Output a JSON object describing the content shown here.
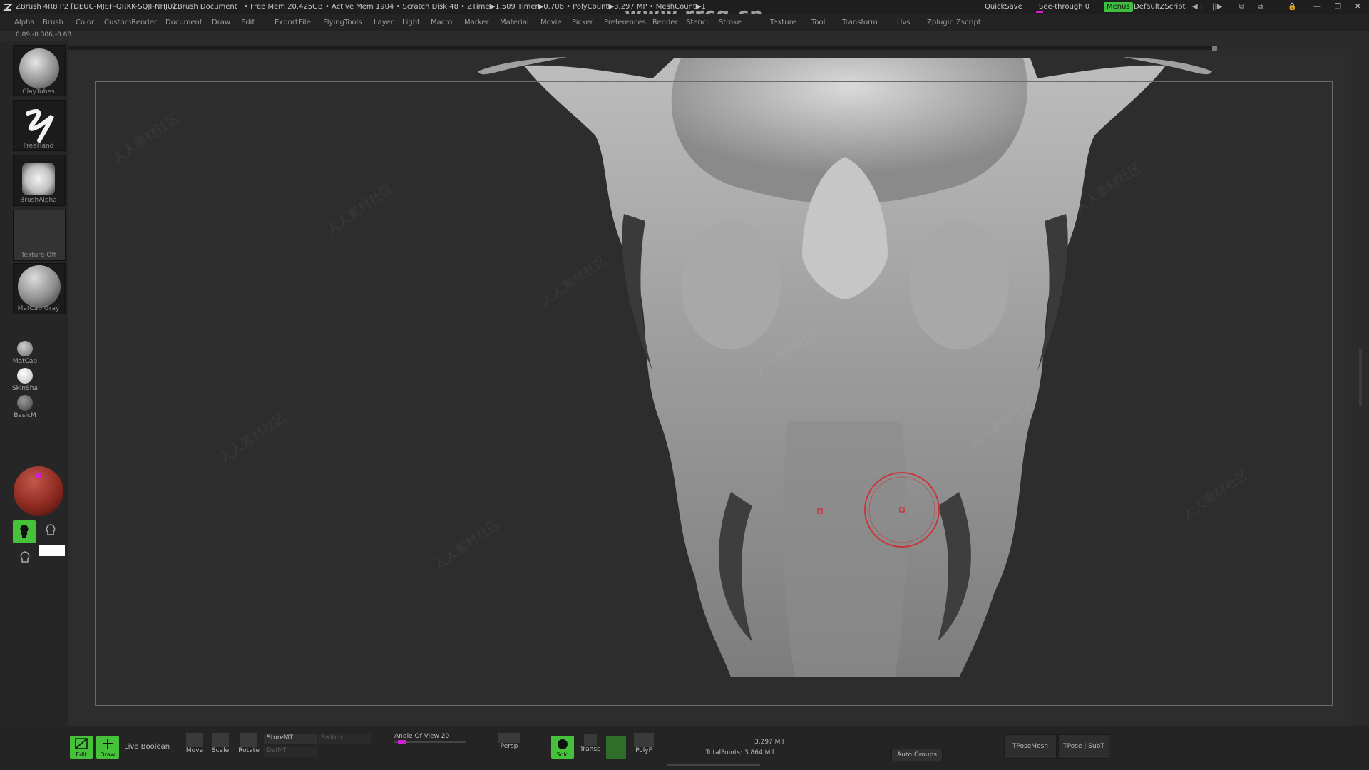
{
  "titlebar": {
    "app": "ZBrush 4R8 P2 [DEUC-MJEF-QRKK-SQJI-NHJU]",
    "doc": "ZBrush Document",
    "stats": "• Free Mem 20.425GB • Active Mem 1904 • Scratch Disk 48 •  ZTime▶1.509 Timer▶0.706 • PolyCount▶3.297 MP  • MeshCount▶1",
    "quicksave": "QuickSave",
    "seethrough": "See-through  0",
    "menus": "Menus",
    "defaultzscript": "DefaultZScript"
  },
  "menus": [
    "Alpha",
    "Brush",
    "Color",
    "CustomRender",
    "Document",
    "Draw",
    "Edit",
    "Export",
    "File",
    "FlyingTools",
    "Layer",
    "Light",
    "Macro",
    "Marker",
    "Material",
    "Movie",
    "Picker",
    "Preferences",
    "Render",
    "Stencil",
    "Stroke",
    "Texture",
    "Tool",
    "Transform",
    "Uvs",
    "Zplugin",
    "Zscript"
  ],
  "coords": "0.09,-0.306,-0.68",
  "watermark_top": "www.rrcg.cn",
  "watermark_tile": "人人素材社区",
  "shelf": {
    "brush": "ClayTubes",
    "stroke": "FreeHand",
    "alpha": "BrushAlpha",
    "texture": "Texture Off",
    "material": "MatCap Gray",
    "mat1": "MatCap",
    "mat2": "SkinSha",
    "mat3": "BasicM"
  },
  "bottom": {
    "edit": "Edit",
    "draw": "Draw",
    "live_boolean": "Live Boolean",
    "move": "Move",
    "scale": "Scale",
    "rotate": "Rotate",
    "storemt": "StoreMT",
    "switch": "Switch",
    "delmt": "DelMT",
    "angle": "Angle Of View 20",
    "persp": "Persp",
    "solo": "Solo",
    "transp": "Transp",
    "polyf": "PolyF",
    "totalpoints1": "3.297 Mil",
    "totalpoints2": "TotalPoints: 3.864 Mil",
    "autogroups": "Auto Groups",
    "tposemesh": "TPoseMesh",
    "tposesubt": "TPose | SubT"
  },
  "colors": {
    "accent_green": "#46c23a",
    "brush_ring": "#c8363c",
    "magenta": "#d21ed2"
  }
}
